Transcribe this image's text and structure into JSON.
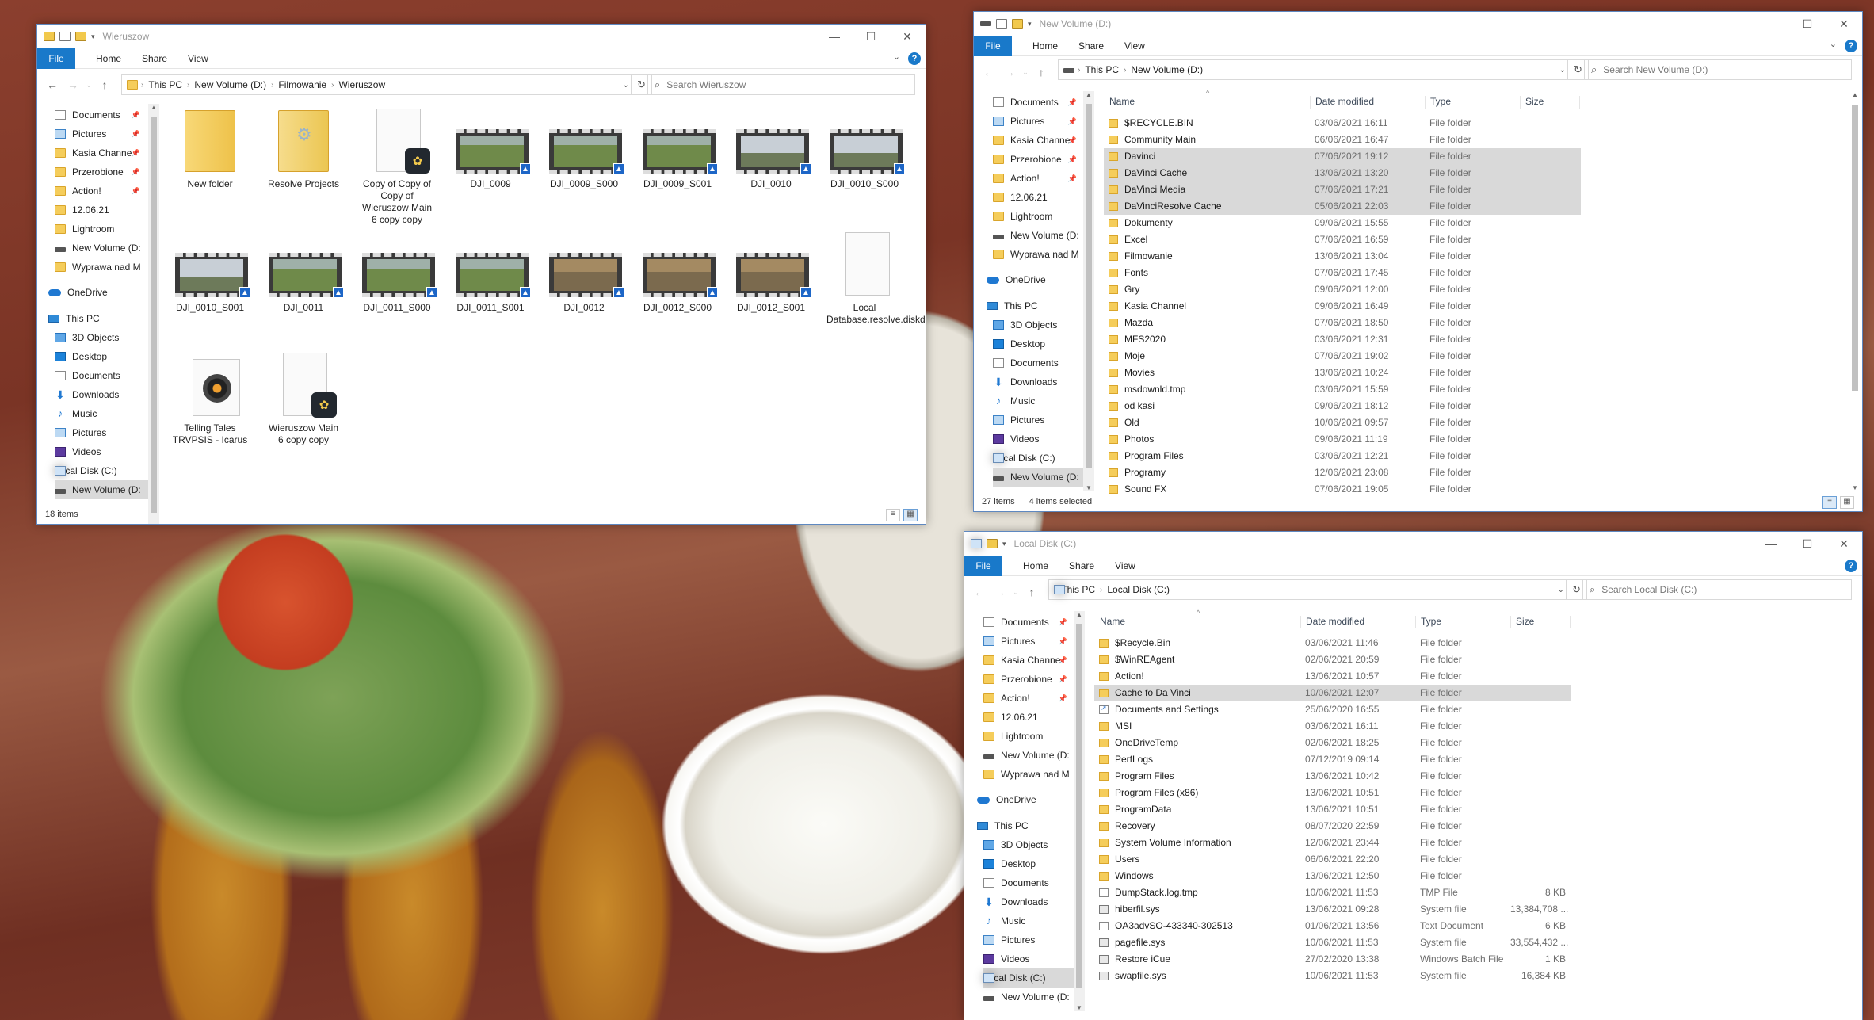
{
  "windows": {
    "w1": {
      "title": "Wieruszow",
      "ribbon": {
        "file": "File",
        "home": "Home",
        "share": "Share",
        "view": "View"
      },
      "breadcrumbs": [
        "This PC",
        "New Volume (D:)",
        "Filmowanie",
        "Wieruszow"
      ],
      "search_placeholder": "Search Wieruszow",
      "status": "18 items",
      "nav": [
        {
          "label": "Documents",
          "icon": "document-icon",
          "pinned": true
        },
        {
          "label": "Pictures",
          "icon": "pictures-icon",
          "pinned": true
        },
        {
          "label": "Kasia Channe",
          "icon": "folder-icon",
          "pinned": true
        },
        {
          "label": "Przerobione",
          "icon": "folder-icon",
          "pinned": true
        },
        {
          "label": "Action!",
          "icon": "folder-icon",
          "pinned": true
        },
        {
          "label": "12.06.21",
          "icon": "folder-icon"
        },
        {
          "label": "Lightroom",
          "icon": "folder-icon"
        },
        {
          "label": "New Volume (D:",
          "icon": "drive-icon"
        },
        {
          "label": "Wyprawa nad M",
          "icon": "folder-icon"
        },
        {
          "label": "",
          "icon": "spacer"
        },
        {
          "label": "OneDrive",
          "icon": "onedrive-icon"
        },
        {
          "label": "",
          "icon": "spacer"
        },
        {
          "label": "This PC",
          "icon": "pc-icon"
        },
        {
          "label": "3D Objects",
          "icon": "cube-icon"
        },
        {
          "label": "Desktop",
          "icon": "desktop-icon"
        },
        {
          "label": "Documents",
          "icon": "document-icon"
        },
        {
          "label": "Downloads",
          "icon": "download-icon"
        },
        {
          "label": "Music",
          "icon": "music-icon"
        },
        {
          "label": "Pictures",
          "icon": "pictures-icon"
        },
        {
          "label": "Videos",
          "icon": "videos-icon"
        },
        {
          "label": "Local Disk (C:)",
          "icon": "windows-drive-icon"
        },
        {
          "label": "New Volume (D:",
          "icon": "drive-icon",
          "selected": true
        }
      ],
      "items": [
        {
          "label": "New folder",
          "kind": "folder"
        },
        {
          "label": "Resolve Projects",
          "kind": "folder-settings"
        },
        {
          "label": "Copy of Copy of Copy of Wieruszow Main 6 copy copy",
          "kind": "resolve"
        },
        {
          "label": "DJI_0009",
          "kind": "video",
          "scene": "field"
        },
        {
          "label": "DJI_0009_S000",
          "kind": "video",
          "scene": "field"
        },
        {
          "label": "DJI_0009_S001",
          "kind": "video",
          "scene": "field"
        },
        {
          "label": "DJI_0010",
          "kind": "video",
          "scene": "sky"
        },
        {
          "label": "DJI_0010_S000",
          "kind": "video",
          "scene": "sky"
        },
        {
          "label": "DJI_0010_S001",
          "kind": "video",
          "scene": "sky"
        },
        {
          "label": "DJI_0011",
          "kind": "video",
          "scene": "field"
        },
        {
          "label": "DJI_0011_S000",
          "kind": "video",
          "scene": "field"
        },
        {
          "label": "DJI_0011_S001",
          "kind": "video",
          "scene": "field"
        },
        {
          "label": "DJI_0012",
          "kind": "video",
          "scene": "brown"
        },
        {
          "label": "DJI_0012_S000",
          "kind": "video",
          "scene": "brown"
        },
        {
          "label": "DJI_0012_S001",
          "kind": "video",
          "scene": "brown"
        },
        {
          "label": "Local Database.resolve.diskdb",
          "kind": "doc"
        },
        {
          "label": "Telling Tales TRVPSIS - Icarus",
          "kind": "audio"
        },
        {
          "label": "Wieruszow Main 6 copy copy",
          "kind": "resolve"
        }
      ]
    },
    "w2": {
      "title": "New Volume (D:)",
      "ribbon": {
        "file": "File",
        "home": "Home",
        "share": "Share",
        "view": "View"
      },
      "breadcrumbs": [
        "This PC",
        "New Volume (D:)"
      ],
      "search_placeholder": "Search New Volume (D:)",
      "status": "27 items",
      "selected_status": "4 items selected",
      "columns": {
        "name": "Name",
        "date": "Date modified",
        "type": "Type",
        "size": "Size"
      },
      "nav": [
        {
          "label": "Documents",
          "icon": "document-icon",
          "pinned": true
        },
        {
          "label": "Pictures",
          "icon": "pictures-icon",
          "pinned": true
        },
        {
          "label": "Kasia Channe",
          "icon": "folder-icon",
          "pinned": true
        },
        {
          "label": "Przerobione",
          "icon": "folder-icon",
          "pinned": true
        },
        {
          "label": "Action!",
          "icon": "folder-icon",
          "pinned": true
        },
        {
          "label": "12.06.21",
          "icon": "folder-icon"
        },
        {
          "label": "Lightroom",
          "icon": "folder-icon"
        },
        {
          "label": "New Volume (D:",
          "icon": "drive-icon"
        },
        {
          "label": "Wyprawa nad M",
          "icon": "folder-icon"
        },
        {
          "label": "",
          "icon": "spacer"
        },
        {
          "label": "OneDrive",
          "icon": "onedrive-icon"
        },
        {
          "label": "",
          "icon": "spacer"
        },
        {
          "label": "This PC",
          "icon": "pc-icon"
        },
        {
          "label": "3D Objects",
          "icon": "cube-icon"
        },
        {
          "label": "Desktop",
          "icon": "desktop-icon"
        },
        {
          "label": "Documents",
          "icon": "document-icon"
        },
        {
          "label": "Downloads",
          "icon": "download-icon"
        },
        {
          "label": "Music",
          "icon": "music-icon"
        },
        {
          "label": "Pictures",
          "icon": "pictures-icon"
        },
        {
          "label": "Videos",
          "icon": "videos-icon"
        },
        {
          "label": "Local Disk (C:)",
          "icon": "windows-drive-icon"
        },
        {
          "label": "New Volume (D:",
          "icon": "drive-icon",
          "selected": true
        }
      ],
      "rows": [
        {
          "name": "$RECYCLE.BIN",
          "date": "03/06/2021 16:11",
          "type": "File folder",
          "size": ""
        },
        {
          "name": "Community Main",
          "date": "06/06/2021 16:47",
          "type": "File folder",
          "size": ""
        },
        {
          "name": "Davinci",
          "date": "07/06/2021 19:12",
          "type": "File folder",
          "size": "",
          "selected": true
        },
        {
          "name": "DaVinci Cache",
          "date": "13/06/2021 13:20",
          "type": "File folder",
          "size": "",
          "selected": true
        },
        {
          "name": "DaVinci Media",
          "date": "07/06/2021 17:21",
          "type": "File folder",
          "size": "",
          "selected": true
        },
        {
          "name": "DaVinciResolve Cache",
          "date": "05/06/2021 22:03",
          "type": "File folder",
          "size": "",
          "selected": true
        },
        {
          "name": "Dokumenty",
          "date": "09/06/2021 15:55",
          "type": "File folder",
          "size": ""
        },
        {
          "name": "Excel",
          "date": "07/06/2021 16:59",
          "type": "File folder",
          "size": ""
        },
        {
          "name": "Filmowanie",
          "date": "13/06/2021 13:04",
          "type": "File folder",
          "size": ""
        },
        {
          "name": "Fonts",
          "date": "07/06/2021 17:45",
          "type": "File folder",
          "size": ""
        },
        {
          "name": "Gry",
          "date": "09/06/2021 12:00",
          "type": "File folder",
          "size": ""
        },
        {
          "name": "Kasia Channel",
          "date": "09/06/2021 16:49",
          "type": "File folder",
          "size": ""
        },
        {
          "name": "Mazda",
          "date": "07/06/2021 18:50",
          "type": "File folder",
          "size": ""
        },
        {
          "name": "MFS2020",
          "date": "03/06/2021 12:31",
          "type": "File folder",
          "size": ""
        },
        {
          "name": "Moje",
          "date": "07/06/2021 19:02",
          "type": "File folder",
          "size": ""
        },
        {
          "name": "Movies",
          "date": "13/06/2021 10:24",
          "type": "File folder",
          "size": ""
        },
        {
          "name": "msdownld.tmp",
          "date": "03/06/2021 15:59",
          "type": "File folder",
          "size": ""
        },
        {
          "name": "od kasi",
          "date": "09/06/2021 18:12",
          "type": "File folder",
          "size": ""
        },
        {
          "name": "Old",
          "date": "10/06/2021 09:57",
          "type": "File folder",
          "size": ""
        },
        {
          "name": "Photos",
          "date": "09/06/2021 11:19",
          "type": "File folder",
          "size": ""
        },
        {
          "name": "Program Files",
          "date": "03/06/2021 12:21",
          "type": "File folder",
          "size": ""
        },
        {
          "name": "Programy",
          "date": "12/06/2021 23:08",
          "type": "File folder",
          "size": ""
        },
        {
          "name": "Sound FX",
          "date": "07/06/2021 19:05",
          "type": "File folder",
          "size": ""
        }
      ]
    },
    "w3": {
      "title": "Local Disk (C:)",
      "ribbon": {
        "file": "File",
        "home": "Home",
        "share": "Share",
        "view": "View"
      },
      "breadcrumbs": [
        "This PC",
        "Local Disk (C:)"
      ],
      "search_placeholder": "Search Local Disk (C:)",
      "columns": {
        "name": "Name",
        "date": "Date modified",
        "type": "Type",
        "size": "Size"
      },
      "nav": [
        {
          "label": "Documents",
          "icon": "document-icon",
          "pinned": true
        },
        {
          "label": "Pictures",
          "icon": "pictures-icon",
          "pinned": true
        },
        {
          "label": "Kasia Channe",
          "icon": "folder-icon",
          "pinned": true
        },
        {
          "label": "Przerobione",
          "icon": "folder-icon",
          "pinned": true
        },
        {
          "label": "Action!",
          "icon": "folder-icon",
          "pinned": true
        },
        {
          "label": "12.06.21",
          "icon": "folder-icon"
        },
        {
          "label": "Lightroom",
          "icon": "folder-icon"
        },
        {
          "label": "New Volume (D:",
          "icon": "drive-icon"
        },
        {
          "label": "Wyprawa nad M",
          "icon": "folder-icon"
        },
        {
          "label": "",
          "icon": "spacer"
        },
        {
          "label": "OneDrive",
          "icon": "onedrive-icon"
        },
        {
          "label": "",
          "icon": "spacer"
        },
        {
          "label": "This PC",
          "icon": "pc-icon"
        },
        {
          "label": "3D Objects",
          "icon": "cube-icon"
        },
        {
          "label": "Desktop",
          "icon": "desktop-icon"
        },
        {
          "label": "Documents",
          "icon": "document-icon"
        },
        {
          "label": "Downloads",
          "icon": "download-icon"
        },
        {
          "label": "Music",
          "icon": "music-icon"
        },
        {
          "label": "Pictures",
          "icon": "pictures-icon"
        },
        {
          "label": "Videos",
          "icon": "videos-icon"
        },
        {
          "label": "Local Disk (C:)",
          "icon": "windows-drive-icon",
          "selected": true
        },
        {
          "label": "New Volume (D:",
          "icon": "drive-icon"
        }
      ],
      "rows": [
        {
          "name": "$Recycle.Bin",
          "date": "03/06/2021 11:46",
          "type": "File folder",
          "size": "",
          "icon": "folder"
        },
        {
          "name": "$WinREAgent",
          "date": "02/06/2021 20:59",
          "type": "File folder",
          "size": "",
          "icon": "folder"
        },
        {
          "name": "Action!",
          "date": "13/06/2021 10:57",
          "type": "File folder",
          "size": "",
          "icon": "folder"
        },
        {
          "name": "Cache fo Da Vinci",
          "date": "10/06/2021 12:07",
          "type": "File folder",
          "size": "",
          "icon": "folder",
          "selected": true
        },
        {
          "name": "Documents and Settings",
          "date": "25/06/2020 16:55",
          "type": "File folder",
          "size": "",
          "icon": "link"
        },
        {
          "name": "MSI",
          "date": "03/06/2021 16:11",
          "type": "File folder",
          "size": "",
          "icon": "folder"
        },
        {
          "name": "OneDriveTemp",
          "date": "02/06/2021 18:25",
          "type": "File folder",
          "size": "",
          "icon": "folder"
        },
        {
          "name": "PerfLogs",
          "date": "07/12/2019 09:14",
          "type": "File folder",
          "size": "",
          "icon": "folder"
        },
        {
          "name": "Program Files",
          "date": "13/06/2021 10:42",
          "type": "File folder",
          "size": "",
          "icon": "folder"
        },
        {
          "name": "Program Files (x86)",
          "date": "13/06/2021 10:51",
          "type": "File folder",
          "size": "",
          "icon": "folder"
        },
        {
          "name": "ProgramData",
          "date": "13/06/2021 10:51",
          "type": "File folder",
          "size": "",
          "icon": "folder"
        },
        {
          "name": "Recovery",
          "date": "08/07/2020 22:59",
          "type": "File folder",
          "size": "",
          "icon": "folder"
        },
        {
          "name": "System Volume Information",
          "date": "12/06/2021 23:44",
          "type": "File folder",
          "size": "",
          "icon": "folder"
        },
        {
          "name": "Users",
          "date": "06/06/2021 22:20",
          "type": "File folder",
          "size": "",
          "icon": "folder"
        },
        {
          "name": "Windows",
          "date": "13/06/2021 12:50",
          "type": "File folder",
          "size": "",
          "icon": "folder"
        },
        {
          "name": "DumpStack.log.tmp",
          "date": "10/06/2021 11:53",
          "type": "TMP File",
          "size": "8 KB",
          "icon": "file"
        },
        {
          "name": "hiberfil.sys",
          "date": "13/06/2021 09:28",
          "type": "System file",
          "size": "13,384,708 ...",
          "icon": "sys"
        },
        {
          "name": "OA3advSO-433340-302513",
          "date": "01/06/2021 13:56",
          "type": "Text Document",
          "size": "6 KB",
          "icon": "file"
        },
        {
          "name": "pagefile.sys",
          "date": "10/06/2021 11:53",
          "type": "System file",
          "size": "33,554,432 ...",
          "icon": "sys"
        },
        {
          "name": "Restore iCue",
          "date": "27/02/2020 13:38",
          "type": "Windows Batch File",
          "size": "1 KB",
          "icon": "sys"
        },
        {
          "name": "swapfile.sys",
          "date": "10/06/2021 11:53",
          "type": "System file",
          "size": "16,384 KB",
          "icon": "sys"
        }
      ]
    }
  },
  "colors": {
    "accent": "#1979ca",
    "selection": "#d9d9d9",
    "border": "#5e88c0"
  }
}
